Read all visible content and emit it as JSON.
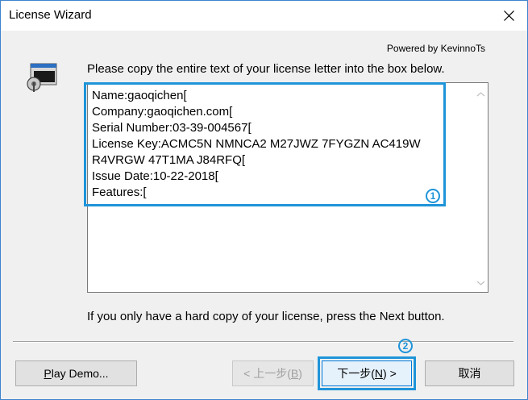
{
  "window": {
    "title": "License Wizard",
    "powered_by": "Powered by KevinnoTs"
  },
  "main": {
    "instruction": "Please copy the entire text of your license letter into the box below.",
    "license_lines": [
      "Name:gaoqichen[",
      "Company:gaoqichen.com[",
      "Serial Number:03-39-004567[",
      "License Key:ACMC5N NMNCA2 M27JWZ 7FYGZN AC419W",
      "R4VRGW 47T1MA J84RFQ[",
      "Issue Date:10-22-2018[",
      "Features:["
    ],
    "hint": "If you only have a hard copy of your license, press the Next button."
  },
  "annotations": {
    "marker_1": "1",
    "marker_2": "2",
    "color": "#1f94d9"
  },
  "buttons": {
    "play_demo_prefix": "P",
    "play_demo_rest": "lay Demo...",
    "back_prefix": "< 上一步(",
    "back_key": "B",
    "back_suffix": ")",
    "next_prefix": "下一步(",
    "next_key": "N",
    "next_suffix": ") >",
    "cancel": "取消"
  },
  "icons": {
    "close": "close-icon",
    "app": "license-app-icon",
    "scroll_up": "chevron-up-icon",
    "scroll_down": "chevron-down-icon"
  }
}
